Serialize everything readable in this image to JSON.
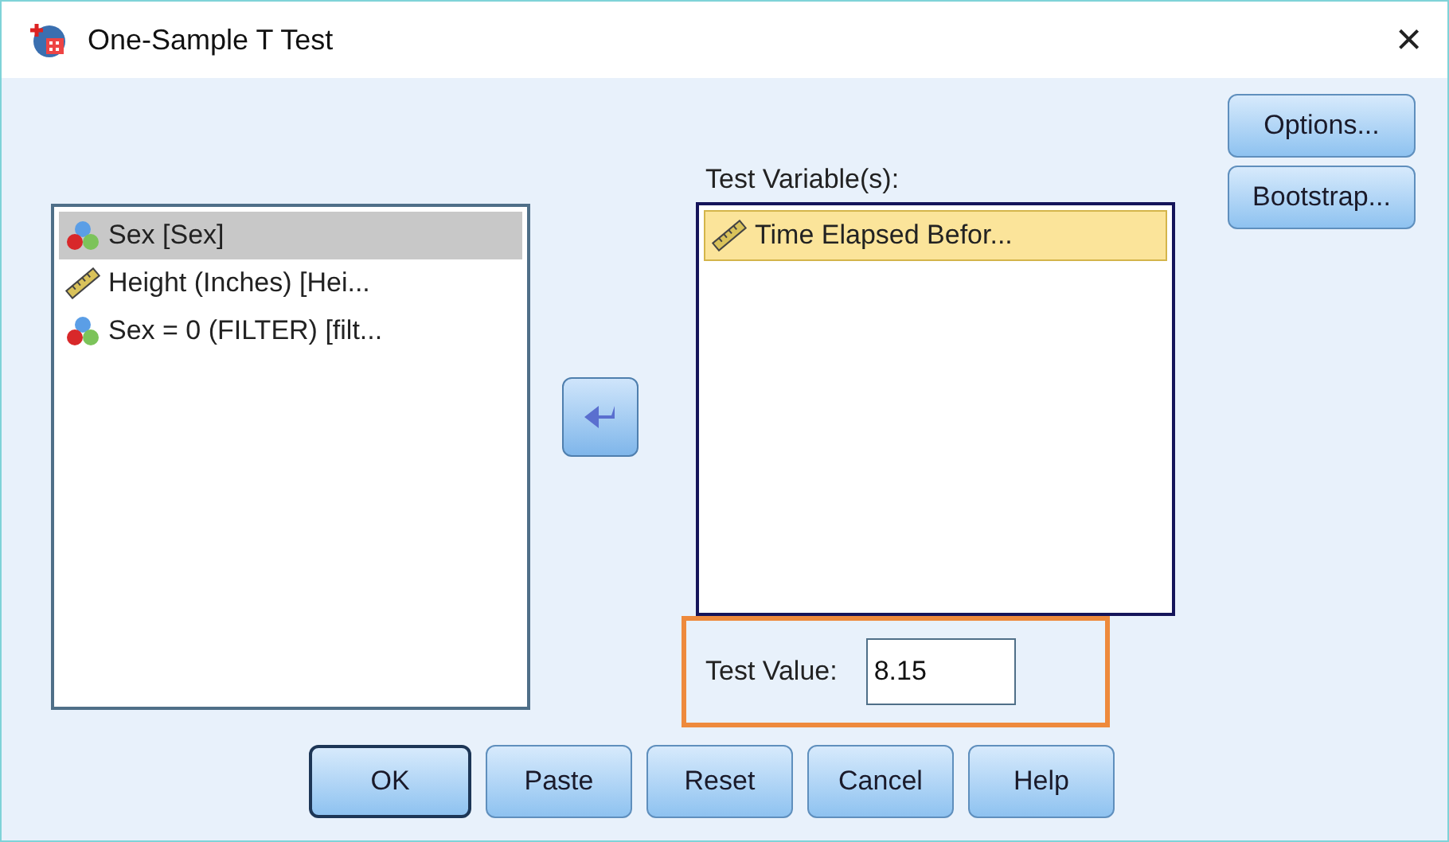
{
  "window": {
    "title": "One-Sample T Test",
    "close": "×"
  },
  "source_list": {
    "items": [
      {
        "label": "Sex [Sex]",
        "kind": "nominal",
        "selected": true
      },
      {
        "label": "Height (Inches) [Hei...",
        "kind": "scale",
        "selected": false
      },
      {
        "label": "Sex = 0 (FILTER) [filt...",
        "kind": "nominal",
        "selected": false
      }
    ]
  },
  "test_variables": {
    "label": "Test Variable(s):",
    "items": [
      {
        "label": "Time Elapsed Befor...",
        "kind": "scale",
        "selected": true
      }
    ]
  },
  "side_buttons": [
    {
      "label": "Options..."
    },
    {
      "label": "Bootstrap..."
    }
  ],
  "test_value": {
    "label": "Test Value:",
    "value": "8.15",
    "highlighted": true
  },
  "buttons": [
    {
      "label": "OK",
      "default": true
    },
    {
      "label": "Paste",
      "default": false
    },
    {
      "label": "Reset",
      "default": false
    },
    {
      "label": "Cancel",
      "default": false
    },
    {
      "label": "Help",
      "default": false
    }
  ]
}
